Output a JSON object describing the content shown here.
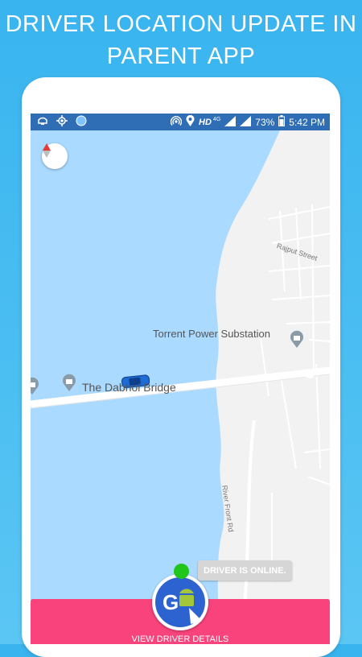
{
  "promo": {
    "headline_line1": "DRIVER LOCATION UPDATE IN",
    "headline_line2": "PARENT APP"
  },
  "status_bar": {
    "network_type": "HD",
    "signal_label": "4G",
    "battery_percent": "73%",
    "time": "5:42 PM",
    "icons": [
      "notification-icon",
      "gps-icon",
      "sync-icon",
      "hotspot-icon",
      "location-icon",
      "signal-icon",
      "battery-icon"
    ]
  },
  "map": {
    "labels": {
      "substation": "Torrent Power Substation",
      "bridge": "The Dabhoi Bridge",
      "street1": "Rajput Street",
      "street2": "River Front Rd"
    },
    "colors": {
      "water": "#aadaff",
      "land": "#f2f2f2",
      "road": "#ffffff",
      "car": "#1e6bd6"
    }
  },
  "driver": {
    "status_text": "DRIVER IS ONLINE.",
    "online_color": "#22c51a",
    "view_details_label": "VIEW DRIVER DETAILS",
    "accent_color": "#f8437d"
  }
}
